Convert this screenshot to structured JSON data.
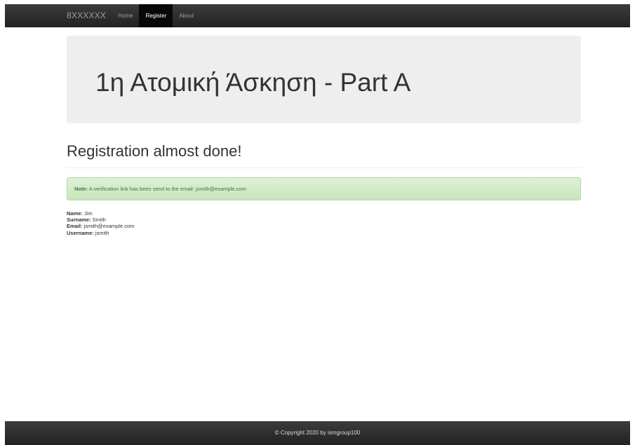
{
  "navbar": {
    "brand": "8XXXXXX",
    "links": [
      {
        "label": "Home",
        "active": false
      },
      {
        "label": "Register",
        "active": true
      },
      {
        "label": "About",
        "active": false
      }
    ]
  },
  "jumbotron": {
    "title": "1η Ατομική Άσκηση - Part A"
  },
  "page_header": {
    "title": "Registration almost done!"
  },
  "alert": {
    "label": "Note:",
    "message": " A verification link has been send to the email: jsmith@example.com"
  },
  "details": [
    {
      "label": "Name:",
      "value": " Jim"
    },
    {
      "label": "Surname:",
      "value": " Smith"
    },
    {
      "label": "Email:",
      "value": " jsmith@example.com"
    },
    {
      "label": "Username:",
      "value": " jsmith"
    }
  ],
  "footer": {
    "text": "© Copyright 2020 by ismgroup100"
  },
  "colors": {
    "navbar": "#222222",
    "active_link_bg": "#080808",
    "jumbotron_bg": "#eeeeee",
    "alert_bg": "#dff0d8",
    "alert_text": "#3c763d"
  }
}
